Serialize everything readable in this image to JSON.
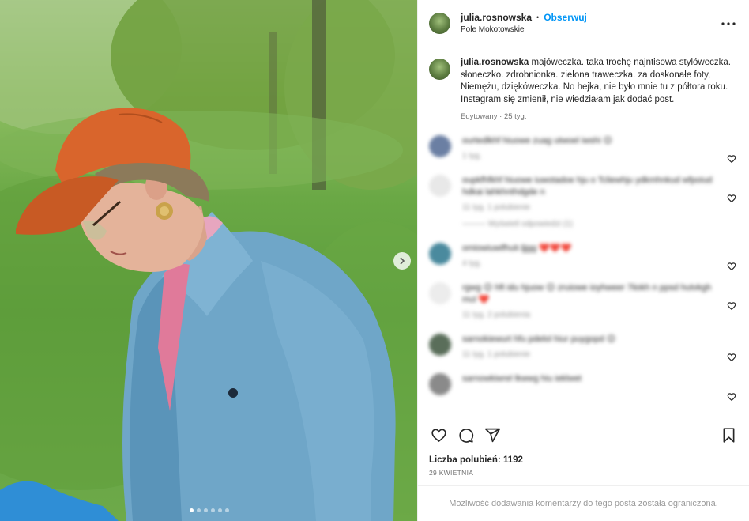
{
  "post": {
    "username": "julia.rosnowska",
    "separator": "•",
    "follow_label": "Obserwuj",
    "location": "Pole Mokotowskie",
    "more_icon": "more-horizontal-icon"
  },
  "caption": {
    "username": "julia.rosnowska",
    "text": "majóweczka. taka trochę najntisowa stylóweczka. słoneczko. zdrobnionka. zielona traweczka. za doskonałe foty, Niemężu, dziękóweczka. No hejka, nie było mnie tu z półtora roku. Instagram się zmienił, nie wiedziałam jak dodać post.",
    "edited_label": "Edytowany",
    "meta_sep": " · ",
    "time": "25 tyg."
  },
  "comments": [
    {
      "avatar_color": "#6b7fa3",
      "text": "ourtedlkhf hiuowe zuag utwoel iwshi 😊",
      "meta": "1 tyg.",
      "replies": ""
    },
    {
      "avatar_color": "#e8e8e8",
      "text": "oupkfhfkhf hiuowe iuwotadoe hju o Tcliewhju ydkmhnkud wfpoiud hdkai lahkhnthdgde n",
      "meta": "11 tyg.    1 polubienie",
      "replies": "———   Wyświetl odpowiedzi (1)"
    },
    {
      "avatar_color": "#4a8a9e",
      "text": "omiowiuwifhulr.ljjgg ❤️❤️❤️",
      "meta": "4 tyg.",
      "replies": ""
    },
    {
      "avatar_color": "#ececec",
      "text": "rgwg 😊 hft idu hjuow 😊 zruiowe ioyhweer 7liokh n ppsd hutvkgh mul ❤️",
      "meta": "11 tyg.    2 polubienia",
      "replies": ""
    },
    {
      "avatar_color": "#5a6e5a",
      "text": "sarnokiewurt hfu pdelol hiur puygopd 😊",
      "meta": "11 tyg.    1 polubienie",
      "replies": ""
    },
    {
      "avatar_color": "#8a8a8a",
      "text": "sarnowkiwrel lkwwg hiu ieklwet",
      "meta": "",
      "replies": ""
    }
  ],
  "actions": {
    "like_icon": "heart-icon",
    "comment_icon": "comment-icon",
    "share_icon": "share-icon",
    "save_icon": "bookmark-icon"
  },
  "likes": {
    "label": "Liczba polubień:",
    "count": "1192"
  },
  "date": "29 KWIETNIA",
  "restricted_message": "Możliwość dodawania komentarzy do tego posta została ograniczona.",
  "carousel": {
    "slides": 6,
    "active": 1
  },
  "colors": {
    "follow": "#0095f6",
    "text": "#262626",
    "muted": "#737373"
  }
}
